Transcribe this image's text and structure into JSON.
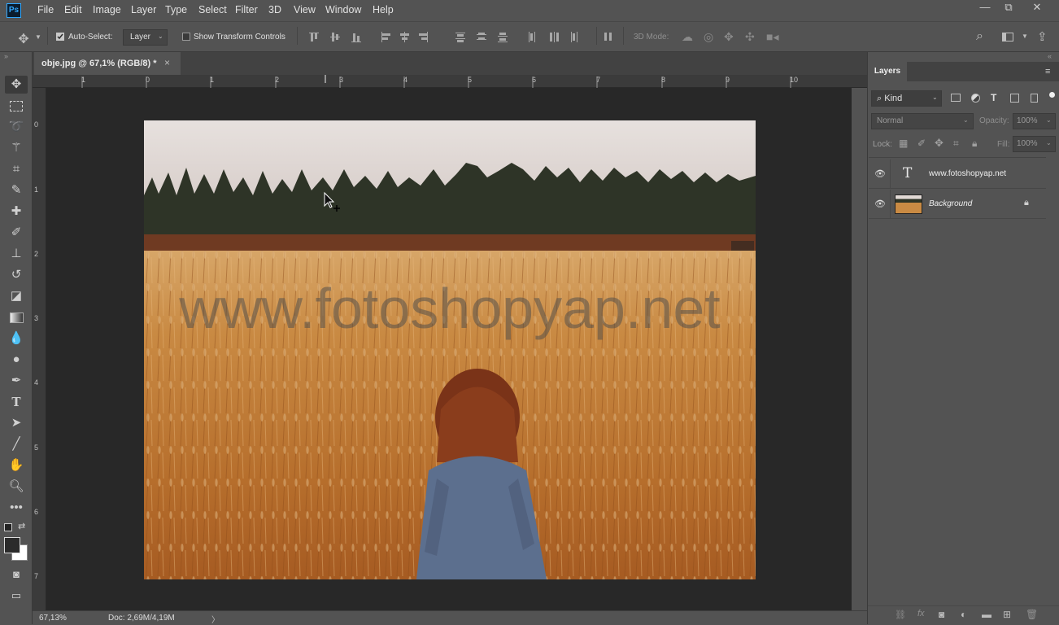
{
  "app": {
    "logo": "Ps"
  },
  "menu": [
    "File",
    "Edit",
    "Image",
    "Layer",
    "Type",
    "Select",
    "Filter",
    "3D",
    "View",
    "Window",
    "Help"
  ],
  "window_controls": {
    "minimize": "—",
    "restore": "⧉",
    "close": "✕"
  },
  "options": {
    "auto_select_label": "Auto-Select:",
    "auto_select_checked": true,
    "auto_select_value": "Layer",
    "transform_controls_label": "Show Transform Controls",
    "transform_controls_checked": false,
    "mode_3d_label": "3D Mode:"
  },
  "tools": [
    "move-tool",
    "marquee-tool",
    "lasso-tool",
    "magic-wand-tool",
    "crop-tool",
    "eyedropper-tool",
    "healing-brush-tool",
    "brush-tool",
    "clone-stamp-tool",
    "history-brush-tool",
    "eraser-tool",
    "gradient-tool",
    "blur-tool",
    "dodge-tool",
    "pen-tool",
    "type-tool",
    "path-selection-tool",
    "line-tool",
    "hand-tool",
    "zoom-tool",
    "more-tools"
  ],
  "document": {
    "tab_title": "obje.jpg @ 67,1% (RGB/8) *",
    "tab_close": "×",
    "watermark_text": "www.fotoshopyap.net"
  },
  "ruler": {
    "horizontal": [
      "1",
      "0",
      "1",
      "2",
      "3",
      "4",
      "5",
      "6",
      "7",
      "8",
      "9",
      "10"
    ],
    "vertical": [
      "0",
      "1",
      "2",
      "3",
      "4",
      "5",
      "6",
      "7"
    ]
  },
  "status": {
    "zoom": "67,13%",
    "doc_info": "Doc: 2,69M/4,19M",
    "arrow": "〉"
  },
  "layers_panel": {
    "tab_label": "Layers",
    "filter_kind": "Kind",
    "blend_mode": "Normal",
    "opacity_label": "Opacity:",
    "opacity_value": "100%",
    "lock_label": "Lock:",
    "fill_label": "Fill:",
    "fill_value": "100%",
    "layers": [
      {
        "name": "www.fotoshopyap.net",
        "type": "text",
        "visible": true
      },
      {
        "name": "Background",
        "type": "image",
        "visible": true,
        "locked": true
      }
    ]
  },
  "colors": {
    "ui_bg": "#535353",
    "canvas_bg": "#282828",
    "dark_panel": "#424242",
    "accent": "#31a8ff"
  }
}
